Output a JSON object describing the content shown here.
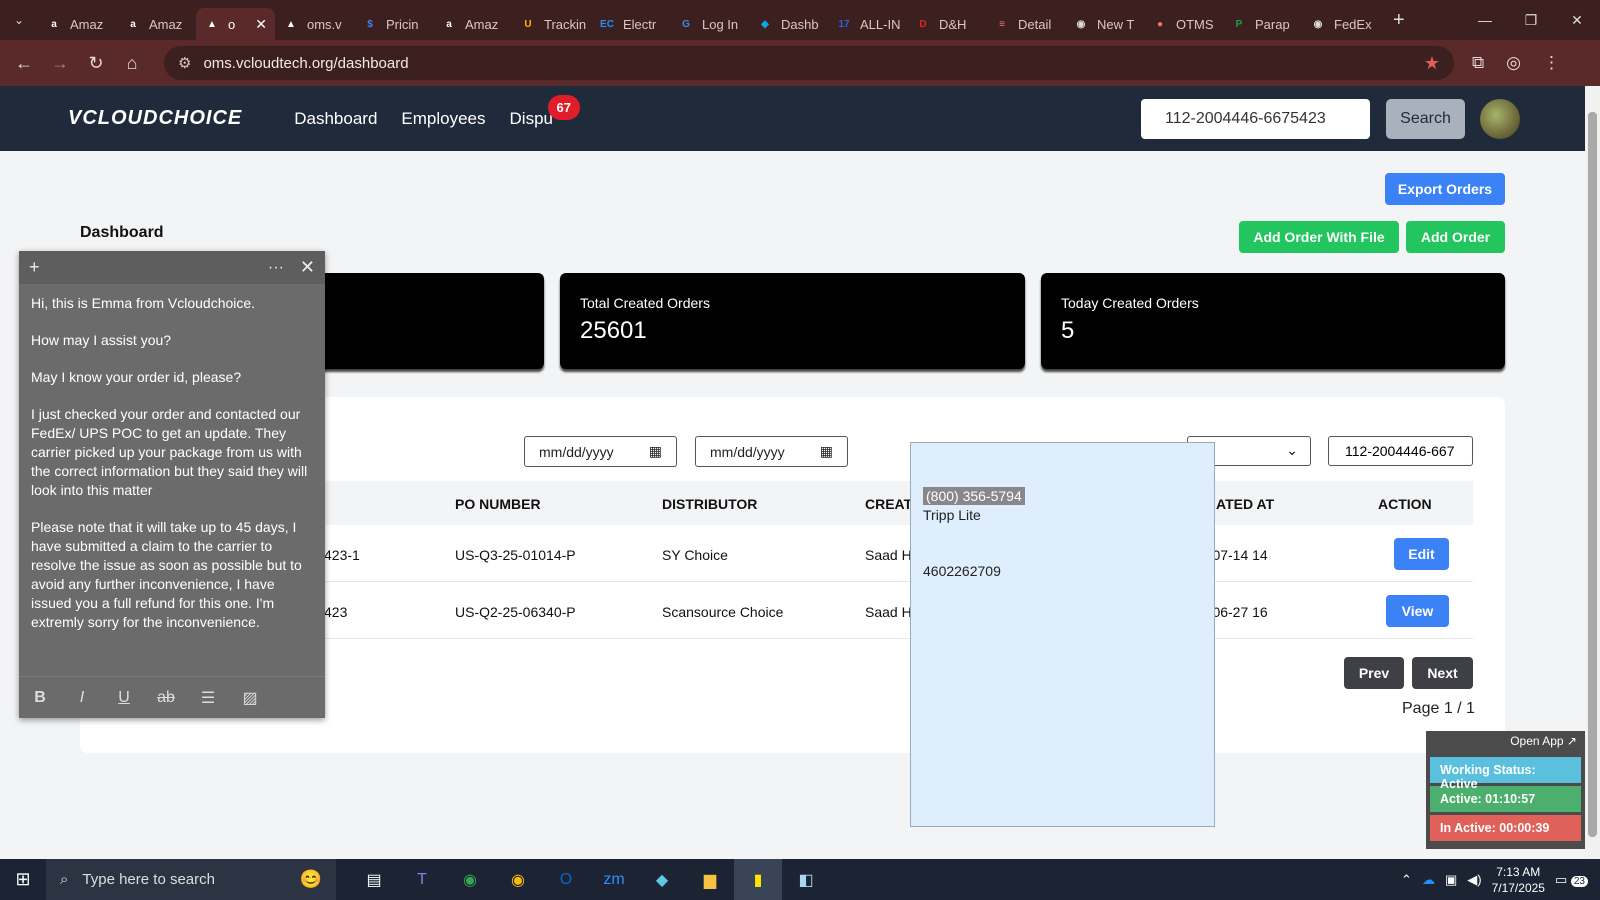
{
  "browser": {
    "tabs": [
      {
        "label": "Amaz",
        "fav": "a",
        "color": "#fff"
      },
      {
        "label": "Amaz",
        "fav": "a",
        "color": "#fff"
      },
      {
        "label": "o",
        "fav": "▲",
        "color": "#fff",
        "active": true
      },
      {
        "label": "oms.v",
        "fav": "▲",
        "color": "#fff"
      },
      {
        "label": "Pricin",
        "fav": "$",
        "color": "#3b82f6"
      },
      {
        "label": "Amaz",
        "fav": "a",
        "color": "#fff"
      },
      {
        "label": "Trackin",
        "fav": "U",
        "color": "#ffb500"
      },
      {
        "label": "Electr",
        "fav": "EC",
        "color": "#1e90ff"
      },
      {
        "label": "Log In",
        "fav": "G",
        "color": "#4285f4"
      },
      {
        "label": "Dashb",
        "fav": "◆",
        "color": "#0ea5e9"
      },
      {
        "label": "ALL-IN",
        "fav": "17",
        "color": "#2563eb"
      },
      {
        "label": "D&H",
        "fav": "D",
        "color": "#dc2626"
      },
      {
        "label": "Detail",
        "fav": "≡",
        "color": "#f87171"
      },
      {
        "label": "New T",
        "fav": "◉",
        "color": "#ddd"
      },
      {
        "label": "OTMS",
        "fav": "●",
        "color": "#f87171"
      },
      {
        "label": "Parap",
        "fav": "P",
        "color": "#16a34a"
      },
      {
        "label": "FedEx",
        "fav": "◉",
        "color": "#ddd"
      }
    ],
    "url": "oms.vcloudtech.org/dashboard"
  },
  "header": {
    "logo": "VCLOUDCHOICE",
    "nav": [
      "Dashboard",
      "Employees",
      "Dispu"
    ],
    "dispute_count": "67",
    "search_value": "112-2004446-6675423",
    "search_button": "Search"
  },
  "actions": {
    "export": "Export Orders",
    "add_with_file": "Add Order With File",
    "add_order": "Add Order"
  },
  "page_title": "Dashboard",
  "stats": [
    {
      "label": "Total Created Orders",
      "value": "25601"
    },
    {
      "label": "Today Created Orders",
      "value": "5"
    }
  ],
  "filters": {
    "date_from": "mm/dd/yyyy",
    "date_to": "mm/dd/yyyy",
    "select_value": "0",
    "search_value": "112-2004446-667"
  },
  "table": {
    "headers": [
      "PO NUMBER",
      "DISTRIBUTOR",
      "CREAT",
      "ATED AT",
      "ACTION"
    ],
    "rows": [
      {
        "order": "423-1",
        "po": "US-Q3-25-01014-P",
        "distributor": "SY Choice",
        "created_by": "Saad H",
        "created_at": "5-07-14 14",
        "action": "Edit"
      },
      {
        "order": "423",
        "po": "US-Q2-25-06340-P",
        "distributor": "Scansource Choice",
        "created_by": "Saad H",
        "created_at": "5-06-27 16",
        "action": "View"
      }
    ]
  },
  "pagination": {
    "prev": "Prev",
    "next": "Next",
    "page": "Page 1 / 1"
  },
  "popup": {
    "phone": "(800) 356-5794",
    "company": "Tripp Lite",
    "number": "4602262709"
  },
  "sticky": {
    "paragraphs": [
      "Hi, this is Emma from Vcloudchoice.",
      "How may I assist you?",
      "May I know your order id, please?",
      "I just checked your order and contacted our FedEx/ UPS POC to get an update. They carrier picked up your package from us with the correct information but they said they will look into this matter",
      "Please note that it will take up to 45 days, I have submitted a claim to the carrier to resolve the issue as soon as possible but to avoid any further inconvenience, I have issued you a full refund for this one. I'm extremly sorry for the inconvenience."
    ]
  },
  "work_status": {
    "open_app": "Open App ↗",
    "status": "Working Status: Active",
    "active": "Active: 01:10:57",
    "inactive": "In Active: 00:00:39"
  },
  "taskbar": {
    "search_placeholder": "Type here to search",
    "time": "7:13 AM",
    "date": "7/17/2025",
    "notifications": "23"
  }
}
